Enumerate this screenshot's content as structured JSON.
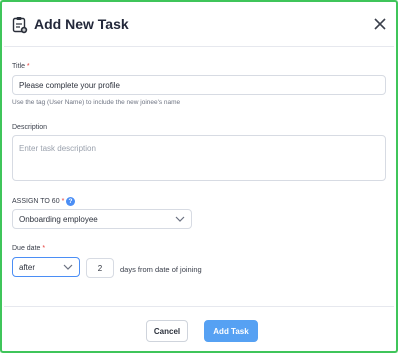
{
  "dialog": {
    "title": "Add New Task",
    "close_icon": "close-icon",
    "task_icon": "task-list-icon"
  },
  "form": {
    "title_label": "Title",
    "title_value": "Please complete your profile",
    "title_help": "Use the tag (User Name) to include the new joinee's name",
    "description_label": "Description",
    "description_placeholder": "Enter task description",
    "assign_label": "ASSIGN TO 60",
    "assign_value": "Onboarding employee",
    "due_label": "Due date",
    "due_relation": "after",
    "due_days": "2",
    "due_suffix": "days from date of joining",
    "required_mark": "*"
  },
  "buttons": {
    "cancel": "Cancel",
    "add": "Add Task"
  },
  "colors": {
    "primary": "#56a1f3",
    "required": "#e53935",
    "frame": "#3fc55a"
  }
}
